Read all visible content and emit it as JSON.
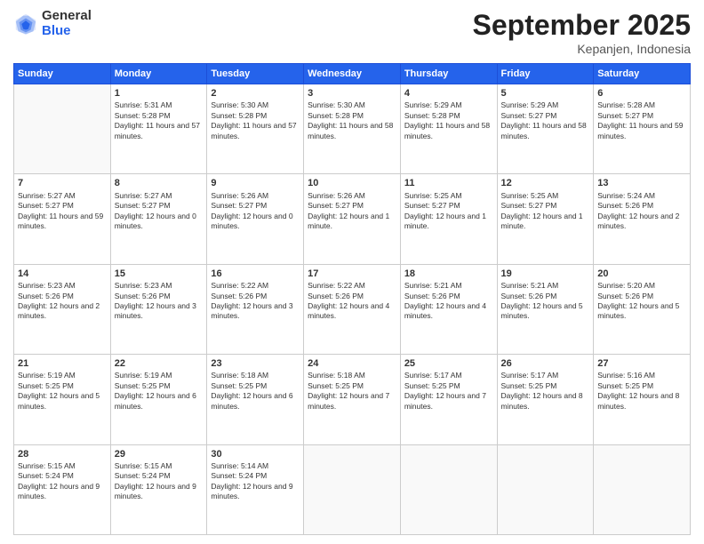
{
  "logo": {
    "general": "General",
    "blue": "Blue"
  },
  "header": {
    "title": "September 2025",
    "location": "Kepanjen, Indonesia"
  },
  "weekdays": [
    "Sunday",
    "Monday",
    "Tuesday",
    "Wednesday",
    "Thursday",
    "Friday",
    "Saturday"
  ],
  "weeks": [
    [
      {
        "day": "",
        "sunrise": "",
        "sunset": "",
        "daylight": ""
      },
      {
        "day": "1",
        "sunrise": "Sunrise: 5:31 AM",
        "sunset": "Sunset: 5:28 PM",
        "daylight": "Daylight: 11 hours and 57 minutes."
      },
      {
        "day": "2",
        "sunrise": "Sunrise: 5:30 AM",
        "sunset": "Sunset: 5:28 PM",
        "daylight": "Daylight: 11 hours and 57 minutes."
      },
      {
        "day": "3",
        "sunrise": "Sunrise: 5:30 AM",
        "sunset": "Sunset: 5:28 PM",
        "daylight": "Daylight: 11 hours and 58 minutes."
      },
      {
        "day": "4",
        "sunrise": "Sunrise: 5:29 AM",
        "sunset": "Sunset: 5:28 PM",
        "daylight": "Daylight: 11 hours and 58 minutes."
      },
      {
        "day": "5",
        "sunrise": "Sunrise: 5:29 AM",
        "sunset": "Sunset: 5:27 PM",
        "daylight": "Daylight: 11 hours and 58 minutes."
      },
      {
        "day": "6",
        "sunrise": "Sunrise: 5:28 AM",
        "sunset": "Sunset: 5:27 PM",
        "daylight": "Daylight: 11 hours and 59 minutes."
      }
    ],
    [
      {
        "day": "7",
        "sunrise": "Sunrise: 5:27 AM",
        "sunset": "Sunset: 5:27 PM",
        "daylight": "Daylight: 11 hours and 59 minutes."
      },
      {
        "day": "8",
        "sunrise": "Sunrise: 5:27 AM",
        "sunset": "Sunset: 5:27 PM",
        "daylight": "Daylight: 12 hours and 0 minutes."
      },
      {
        "day": "9",
        "sunrise": "Sunrise: 5:26 AM",
        "sunset": "Sunset: 5:27 PM",
        "daylight": "Daylight: 12 hours and 0 minutes."
      },
      {
        "day": "10",
        "sunrise": "Sunrise: 5:26 AM",
        "sunset": "Sunset: 5:27 PM",
        "daylight": "Daylight: 12 hours and 1 minute."
      },
      {
        "day": "11",
        "sunrise": "Sunrise: 5:25 AM",
        "sunset": "Sunset: 5:27 PM",
        "daylight": "Daylight: 12 hours and 1 minute."
      },
      {
        "day": "12",
        "sunrise": "Sunrise: 5:25 AM",
        "sunset": "Sunset: 5:27 PM",
        "daylight": "Daylight: 12 hours and 1 minute."
      },
      {
        "day": "13",
        "sunrise": "Sunrise: 5:24 AM",
        "sunset": "Sunset: 5:26 PM",
        "daylight": "Daylight: 12 hours and 2 minutes."
      }
    ],
    [
      {
        "day": "14",
        "sunrise": "Sunrise: 5:23 AM",
        "sunset": "Sunset: 5:26 PM",
        "daylight": "Daylight: 12 hours and 2 minutes."
      },
      {
        "day": "15",
        "sunrise": "Sunrise: 5:23 AM",
        "sunset": "Sunset: 5:26 PM",
        "daylight": "Daylight: 12 hours and 3 minutes."
      },
      {
        "day": "16",
        "sunrise": "Sunrise: 5:22 AM",
        "sunset": "Sunset: 5:26 PM",
        "daylight": "Daylight: 12 hours and 3 minutes."
      },
      {
        "day": "17",
        "sunrise": "Sunrise: 5:22 AM",
        "sunset": "Sunset: 5:26 PM",
        "daylight": "Daylight: 12 hours and 4 minutes."
      },
      {
        "day": "18",
        "sunrise": "Sunrise: 5:21 AM",
        "sunset": "Sunset: 5:26 PM",
        "daylight": "Daylight: 12 hours and 4 minutes."
      },
      {
        "day": "19",
        "sunrise": "Sunrise: 5:21 AM",
        "sunset": "Sunset: 5:26 PM",
        "daylight": "Daylight: 12 hours and 5 minutes."
      },
      {
        "day": "20",
        "sunrise": "Sunrise: 5:20 AM",
        "sunset": "Sunset: 5:26 PM",
        "daylight": "Daylight: 12 hours and 5 minutes."
      }
    ],
    [
      {
        "day": "21",
        "sunrise": "Sunrise: 5:19 AM",
        "sunset": "Sunset: 5:25 PM",
        "daylight": "Daylight: 12 hours and 5 minutes."
      },
      {
        "day": "22",
        "sunrise": "Sunrise: 5:19 AM",
        "sunset": "Sunset: 5:25 PM",
        "daylight": "Daylight: 12 hours and 6 minutes."
      },
      {
        "day": "23",
        "sunrise": "Sunrise: 5:18 AM",
        "sunset": "Sunset: 5:25 PM",
        "daylight": "Daylight: 12 hours and 6 minutes."
      },
      {
        "day": "24",
        "sunrise": "Sunrise: 5:18 AM",
        "sunset": "Sunset: 5:25 PM",
        "daylight": "Daylight: 12 hours and 7 minutes."
      },
      {
        "day": "25",
        "sunrise": "Sunrise: 5:17 AM",
        "sunset": "Sunset: 5:25 PM",
        "daylight": "Daylight: 12 hours and 7 minutes."
      },
      {
        "day": "26",
        "sunrise": "Sunrise: 5:17 AM",
        "sunset": "Sunset: 5:25 PM",
        "daylight": "Daylight: 12 hours and 8 minutes."
      },
      {
        "day": "27",
        "sunrise": "Sunrise: 5:16 AM",
        "sunset": "Sunset: 5:25 PM",
        "daylight": "Daylight: 12 hours and 8 minutes."
      }
    ],
    [
      {
        "day": "28",
        "sunrise": "Sunrise: 5:15 AM",
        "sunset": "Sunset: 5:24 PM",
        "daylight": "Daylight: 12 hours and 9 minutes."
      },
      {
        "day": "29",
        "sunrise": "Sunrise: 5:15 AM",
        "sunset": "Sunset: 5:24 PM",
        "daylight": "Daylight: 12 hours and 9 minutes."
      },
      {
        "day": "30",
        "sunrise": "Sunrise: 5:14 AM",
        "sunset": "Sunset: 5:24 PM",
        "daylight": "Daylight: 12 hours and 9 minutes."
      },
      {
        "day": "",
        "sunrise": "",
        "sunset": "",
        "daylight": ""
      },
      {
        "day": "",
        "sunrise": "",
        "sunset": "",
        "daylight": ""
      },
      {
        "day": "",
        "sunrise": "",
        "sunset": "",
        "daylight": ""
      },
      {
        "day": "",
        "sunrise": "",
        "sunset": "",
        "daylight": ""
      }
    ]
  ]
}
